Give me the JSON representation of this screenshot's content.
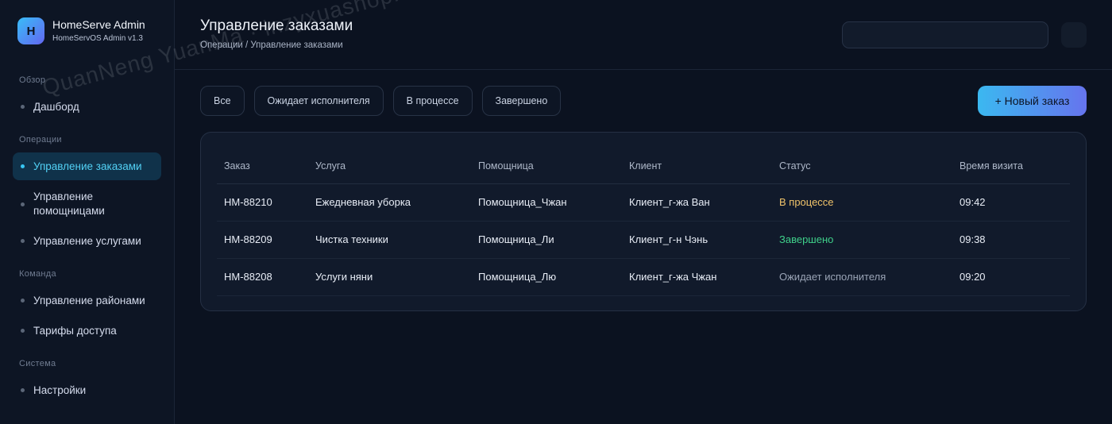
{
  "brand": {
    "logo_letter": "H",
    "title": "HomeServe Admin",
    "subtitle": "HomeServOS Admin v1.3"
  },
  "sidebar": {
    "sections": [
      {
        "title": "Обзор",
        "items": [
          {
            "label": "Дашборд",
            "active": false
          }
        ]
      },
      {
        "title": "Операции",
        "items": [
          {
            "label": "Управление заказами",
            "active": true
          },
          {
            "label": "Управление помощницами",
            "active": false
          },
          {
            "label": "Управление услугами",
            "active": false
          }
        ]
      },
      {
        "title": "Команда",
        "items": [
          {
            "label": "Управление районами",
            "active": false
          },
          {
            "label": "Тарифы доступа",
            "active": false
          }
        ]
      },
      {
        "title": "Система",
        "items": [
          {
            "label": "Настройки",
            "active": false
          }
        ]
      }
    ]
  },
  "header": {
    "title": "Управление заказами",
    "breadcrumb": "Операции / Управление заказами"
  },
  "filters": [
    "Все",
    "Ожидает исполнителя",
    "В процессе",
    "Завершено"
  ],
  "new_order_label": "+ Новый заказ",
  "table": {
    "columns": [
      "Заказ",
      "Услуга",
      "Помощница",
      "Клиент",
      "Статус",
      "Время визита"
    ],
    "rows": [
      {
        "order": "HM-88210",
        "service": "Ежедневная уборка",
        "helper": "Помощница_Чжан",
        "client": "Клиент_г-жа Ван",
        "status": "В процессе",
        "time": "09:42"
      },
      {
        "order": "HM-88209",
        "service": "Чистка техники",
        "helper": "Помощница_Ли",
        "client": "Клиент_г-н Чэнь",
        "status": "Завершено",
        "time": "09:38"
      },
      {
        "order": "HM-88208",
        "service": "Услуги няни",
        "helper": "Помощница_Лю",
        "client": "Клиент_г-жа Чжан",
        "status": "Ожидает исполнителя",
        "time": "09:20"
      }
    ]
  },
  "colors": {
    "accent": "#38c6f2",
    "status_progress": "#f0c36a",
    "status_done": "#3fd08a",
    "status_waiting": "#9aa4b6"
  },
  "watermark": "QuanNeng YuanMa · inzyxuashop.com"
}
